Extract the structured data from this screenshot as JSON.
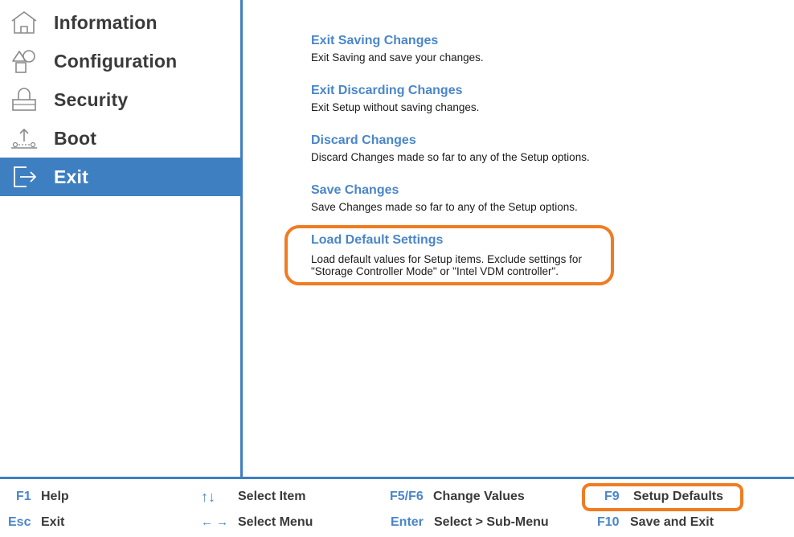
{
  "sidebar": {
    "items": [
      {
        "label": "Information",
        "icon": "home-icon"
      },
      {
        "label": "Configuration",
        "icon": "shapes-icon"
      },
      {
        "label": "Security",
        "icon": "lock-icon"
      },
      {
        "label": "Boot",
        "icon": "boot-icon"
      },
      {
        "label": "Exit",
        "icon": "exit-icon",
        "active": true
      }
    ]
  },
  "main": {
    "options": [
      {
        "title": "Exit Saving Changes",
        "desc": "Exit Saving and save your changes."
      },
      {
        "title": "Exit Discarding Changes",
        "desc": "Exit Setup without saving changes."
      },
      {
        "title": "Discard Changes",
        "desc": "Discard Changes made so far to any of the Setup options."
      },
      {
        "title": "Save Changes",
        "desc": "Save Changes made so far to any of the Setup options."
      },
      {
        "title": "Load Default Settings",
        "desc": "Load default values for Setup items. Exclude settings for\n\"Storage Controller Mode\" or \"Intel VDM controller\"."
      }
    ]
  },
  "footer": {
    "keys": [
      {
        "key": "F1",
        "label": "Help"
      },
      {
        "key": "Esc",
        "label": "Exit"
      },
      {
        "key": "↑↓",
        "label": "Select Item"
      },
      {
        "key": "← →",
        "label": "Select Menu"
      },
      {
        "key": "F5/F6",
        "label": "Change Values"
      },
      {
        "key": "Enter",
        "label": "Select > Sub-Menu"
      },
      {
        "key": "F9",
        "label": "Setup Defaults"
      },
      {
        "key": "F10",
        "label": "Save and Exit"
      }
    ]
  },
  "colors": {
    "accent": "#3e7fc1",
    "link": "#4a86c8",
    "highlight": "#f07c22"
  }
}
